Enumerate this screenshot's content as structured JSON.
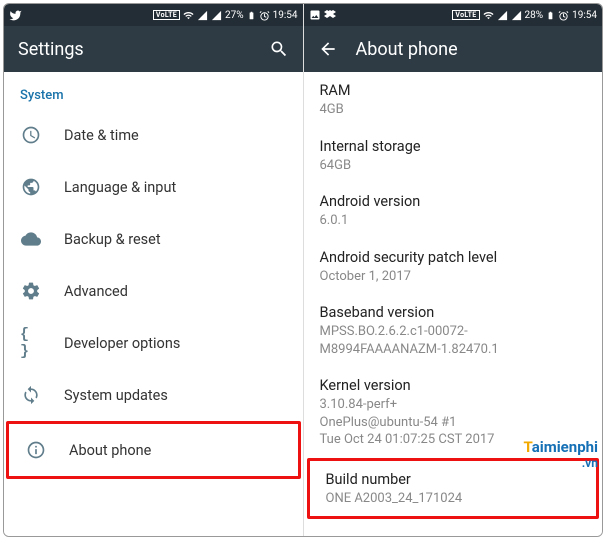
{
  "status": {
    "battery_left": "27%",
    "time_left": "19:54",
    "battery_right": "28%",
    "time_right": "19:54",
    "volte": "VoLTE"
  },
  "left": {
    "title": "Settings",
    "section": "System",
    "items": [
      {
        "label": "Date & time"
      },
      {
        "label": "Language & input"
      },
      {
        "label": "Backup & reset"
      },
      {
        "label": "Advanced"
      },
      {
        "label": "Developer options"
      },
      {
        "label": "System updates"
      },
      {
        "label": "About phone"
      }
    ]
  },
  "right": {
    "title": "About phone",
    "details": [
      {
        "title": "RAM",
        "value": "4GB"
      },
      {
        "title": "Internal storage",
        "value": "64GB"
      },
      {
        "title": "Android version",
        "value": "6.0.1"
      },
      {
        "title": "Android security patch level",
        "value": "October 1, 2017"
      },
      {
        "title": "Baseband version",
        "value": "MPSS.BO.2.6.2.c1-00072-M8994FAAAANAZM-1.82470.1"
      },
      {
        "title": "Kernel version",
        "value": "3.10.84-perf+\nOnePlus@ubuntu-54 #1\nTue Oct 24 01:07:25 CST 2017"
      },
      {
        "title": "Build number",
        "value": "ONE A2003_24_171024"
      }
    ]
  },
  "watermark": {
    "brand_t": "T",
    "brand_rest": "aimienphi",
    "suffix": ".vn"
  }
}
